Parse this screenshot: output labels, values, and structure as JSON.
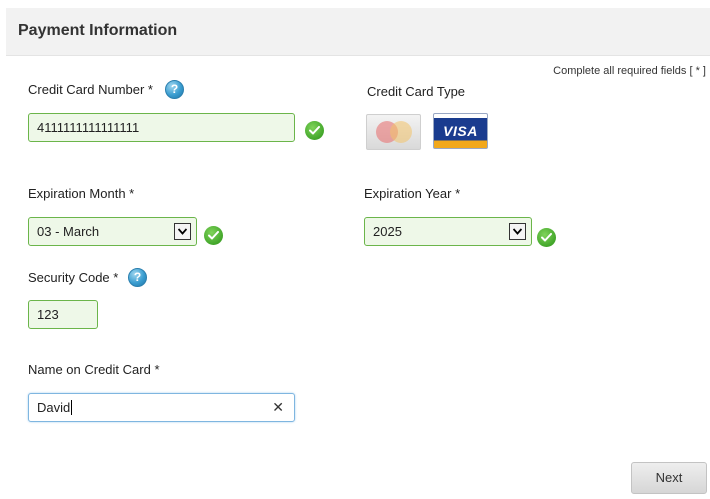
{
  "header": {
    "title": "Payment Information"
  },
  "required_note": "Complete all required fields [ * ]",
  "card_number": {
    "label": "Credit Card Number *",
    "value": "4111111111111111",
    "help_glyph": "?"
  },
  "card_type": {
    "label": "Credit Card Type",
    "options": [
      {
        "name": "MasterCard",
        "icon": "mastercard-icon"
      },
      {
        "name": "VISA",
        "icon": "visa-icon"
      }
    ]
  },
  "expiration_month": {
    "label": "Expiration Month *",
    "value": "03 - March"
  },
  "expiration_year": {
    "label": "Expiration Year *",
    "value": "2025"
  },
  "security_code": {
    "label": "Security Code *",
    "value": "123",
    "help_glyph": "?"
  },
  "name_on_card": {
    "label": "Name on Credit Card *",
    "value": "David",
    "clear_glyph": "✕"
  },
  "actions": {
    "next_label": "Next"
  },
  "colors": {
    "valid_border": "#6bb54a",
    "valid_fill": "#eef8e8",
    "focus_border": "#7fb6e0",
    "help_blue": "#3a9dd0",
    "check_green": "#42a62a"
  }
}
